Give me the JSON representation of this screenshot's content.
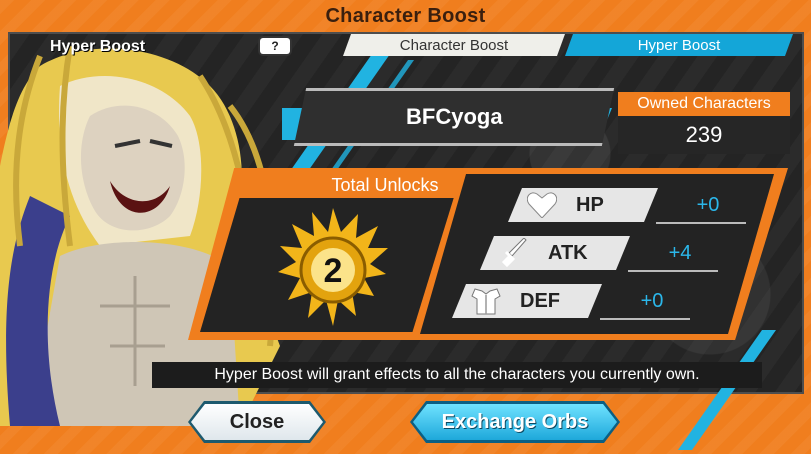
{
  "dialog": {
    "title": "Character Boost",
    "section_label": "Hyper Boost",
    "help_label": "?"
  },
  "tabs": [
    {
      "label": "Character Boost",
      "active": false
    },
    {
      "label": "Hyper Boost",
      "active": true
    }
  ],
  "player": {
    "name": "BFCyoga",
    "owned_characters_label": "Owned Characters",
    "owned_characters_value": "239"
  },
  "unlocks": {
    "label": "Total Unlocks",
    "value": "2"
  },
  "stats": [
    {
      "label": "HP",
      "value": "+0",
      "icon": "heart-icon"
    },
    {
      "label": "ATK",
      "value": "+4",
      "icon": "sword-icon"
    },
    {
      "label": "DEF",
      "value": "+0",
      "icon": "armor-icon"
    }
  ],
  "info_text": "Hyper Boost will grant effects to all the characters you currently own.",
  "buttons": {
    "close": "Close",
    "exchange": "Exchange Orbs"
  },
  "colors": {
    "frame_orange": "#f07e1e",
    "accent_blue": "#21b3e1",
    "panel_dark": "#232323"
  }
}
